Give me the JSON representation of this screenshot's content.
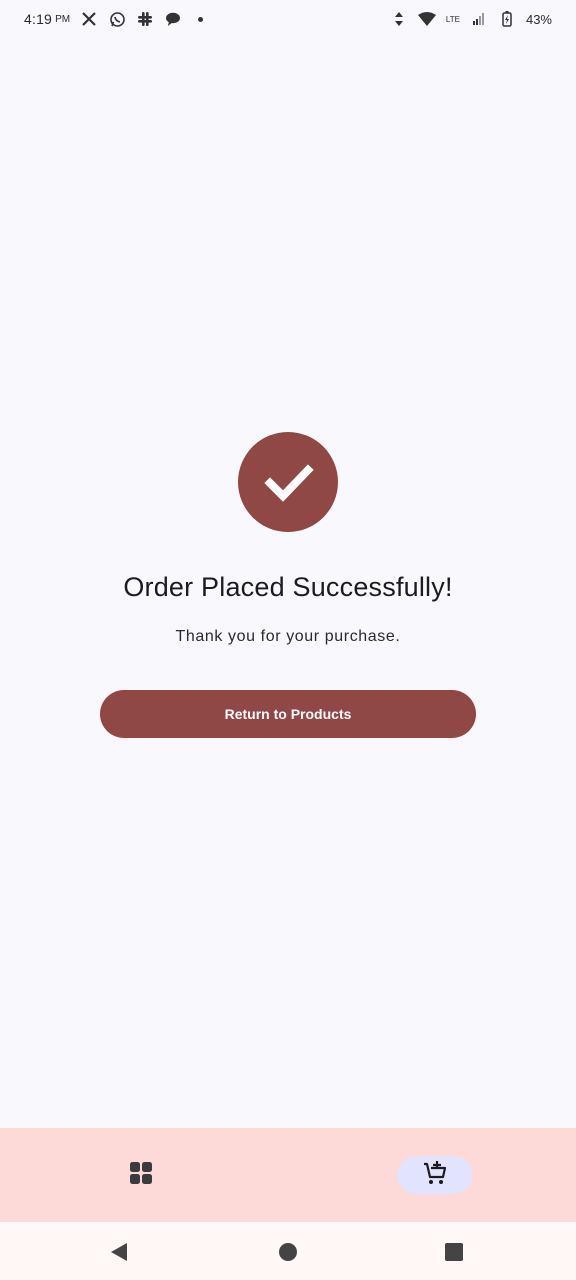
{
  "status_bar": {
    "time": "4:19",
    "ampm": "PM",
    "notification_icons": [
      "x-icon",
      "whatsapp-icon",
      "slack-icon",
      "chat-icon"
    ],
    "network": "LTE",
    "battery": "43%"
  },
  "success": {
    "icon": "check-icon",
    "title": "Order Placed Successfully!",
    "message": "Thank you for your purchase.",
    "button_label": "Return to Products"
  },
  "bottom_nav": {
    "items": [
      {
        "icon": "grid-icon",
        "selected": false
      },
      {
        "icon": "cart-icon",
        "selected": true
      }
    ]
  },
  "colors": {
    "accent": "#8f4843",
    "background": "#f8f8fd",
    "nav_background": "#fdd9d7",
    "nav_indicator": "#e2e3fc"
  }
}
